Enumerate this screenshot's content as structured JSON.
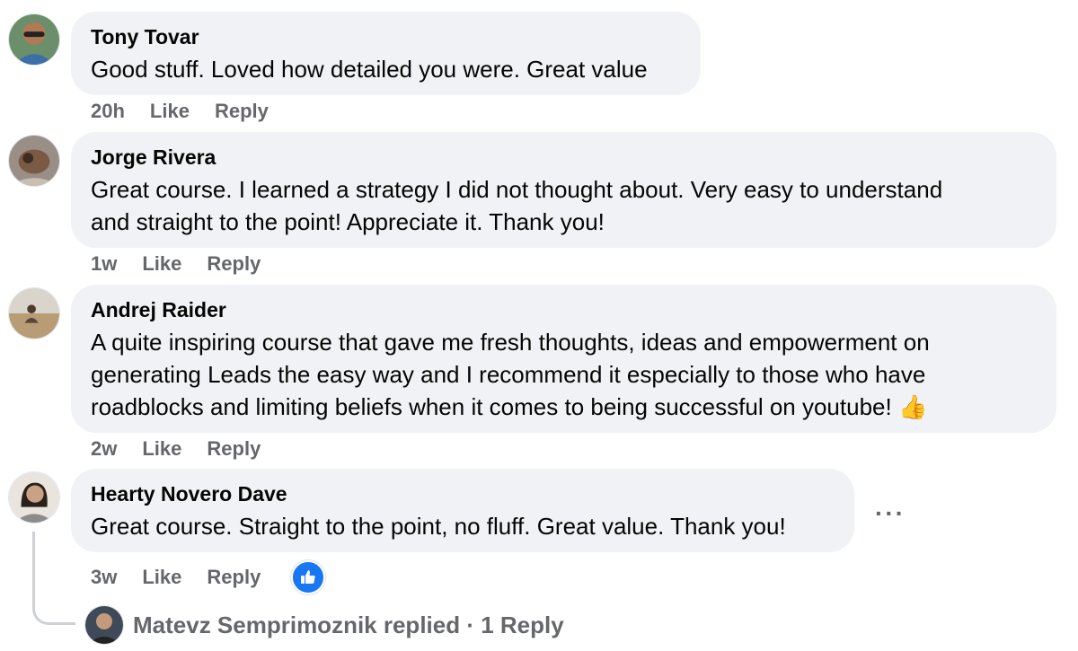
{
  "comments": [
    {
      "author": "Tony Tovar",
      "text_lines": [
        "Good stuff. Loved how detailed you were. Great value"
      ],
      "time": "20h",
      "like_label": "Like",
      "reply_label": "Reply"
    },
    {
      "author": "Jorge Rivera",
      "text_lines": [
        "Great course. I learned a strategy I did not thought about. Very easy to understand",
        "and straight to the point! Appreciate it. Thank you!"
      ],
      "time": "1w",
      "like_label": "Like",
      "reply_label": "Reply"
    },
    {
      "author": "Andrej Raider",
      "text_lines": [
        "A quite inspiring course that gave me fresh thoughts, ideas and empowerment on",
        "generating Leads the easy way and I recommend it especially to those who have",
        "roadblocks and limiting beliefs when it comes to being successful on youtube!"
      ],
      "emoji": "👍",
      "time": "2w",
      "like_label": "Like",
      "reply_label": "Reply"
    },
    {
      "author": "Hearty Novero Dave",
      "text_lines": [
        "Great course. Straight to the point, no fluff. Great value. Thank you!"
      ],
      "time": "3w",
      "like_label": "Like",
      "reply_label": "Reply"
    }
  ],
  "more_options": "···",
  "replies_link": "Matevz Semprimoznik replied · 1 Reply",
  "icons": {
    "reaction": "like-icon",
    "options": "more-options-icon"
  },
  "colors": {
    "bubble": "#f0f2f5",
    "meta": "#65676b",
    "like_blue": "#1877f2"
  }
}
